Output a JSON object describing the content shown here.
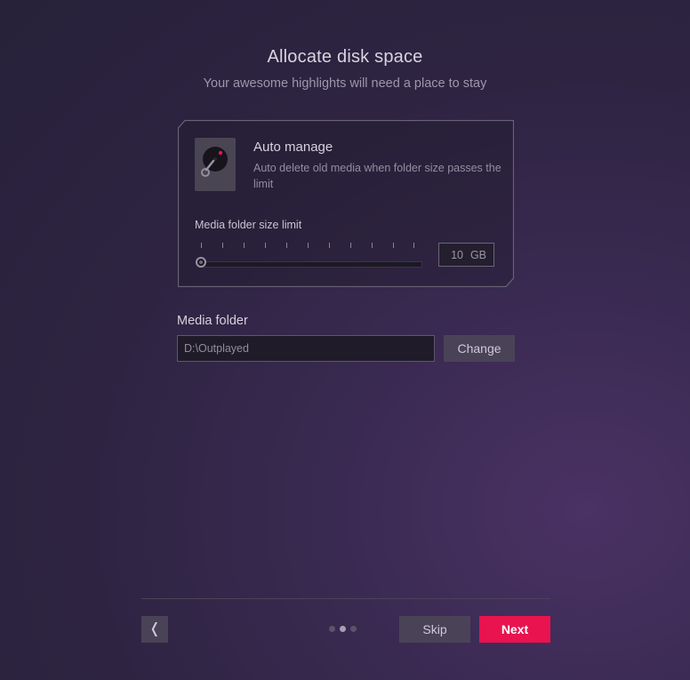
{
  "header": {
    "title": "Allocate disk space",
    "subtitle": "Your awesome highlights will need a place to stay"
  },
  "auto_manage": {
    "icon": "hard-disk-icon",
    "title": "Auto manage",
    "description": "Auto delete old media when folder size passes the limit",
    "limit_label": "Media folder size limit",
    "limit_value": "10",
    "limit_unit": "GB",
    "slider_fraction": 0
  },
  "media_folder": {
    "label": "Media folder",
    "path": "D:\\Outplayed",
    "change_label": "Change"
  },
  "footer": {
    "back_glyph": "❬",
    "skip_label": "Skip",
    "next_label": "Next",
    "pages": 3,
    "active_page": 2
  },
  "colors": {
    "accent": "#e8134f",
    "button_bg": "#4a4358",
    "disk_dot": "#e8134f"
  }
}
